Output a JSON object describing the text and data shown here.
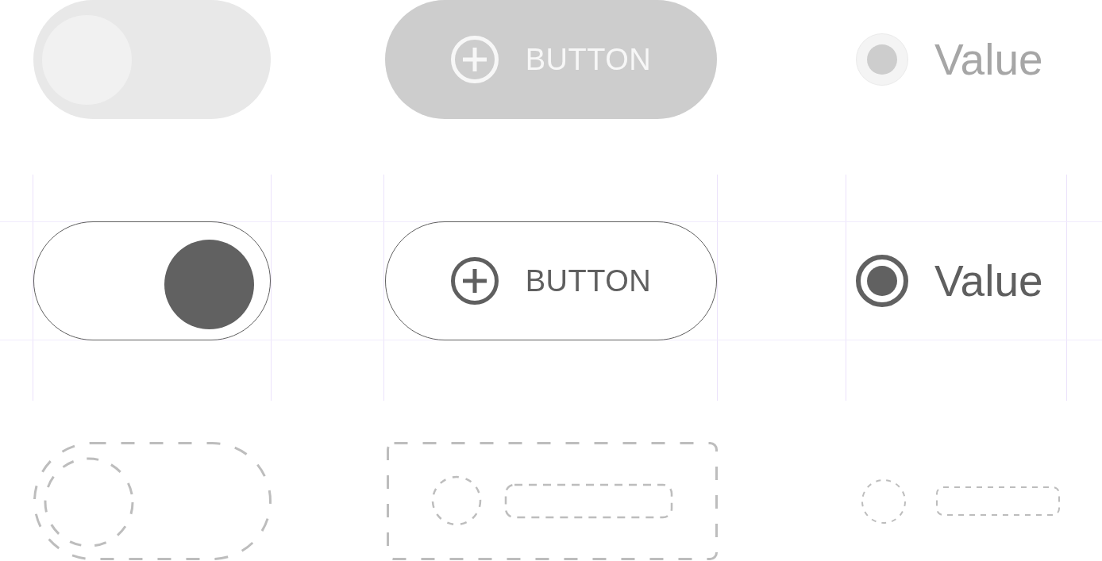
{
  "rows": [
    {
      "kind": "control",
      "toggle": {
        "on": false,
        "disabled": true
      },
      "button": {
        "label": "BUTTON",
        "disabled": true
      },
      "radio": {
        "label": "Value",
        "selected": true,
        "disabled": true
      }
    },
    {
      "kind": "control",
      "guides": true,
      "toggle": {
        "on": true,
        "disabled": false
      },
      "button": {
        "label": "BUTTON",
        "disabled": false
      },
      "radio": {
        "label": "Value",
        "selected": true,
        "disabled": false
      }
    },
    {
      "kind": "wireframe"
    }
  ]
}
